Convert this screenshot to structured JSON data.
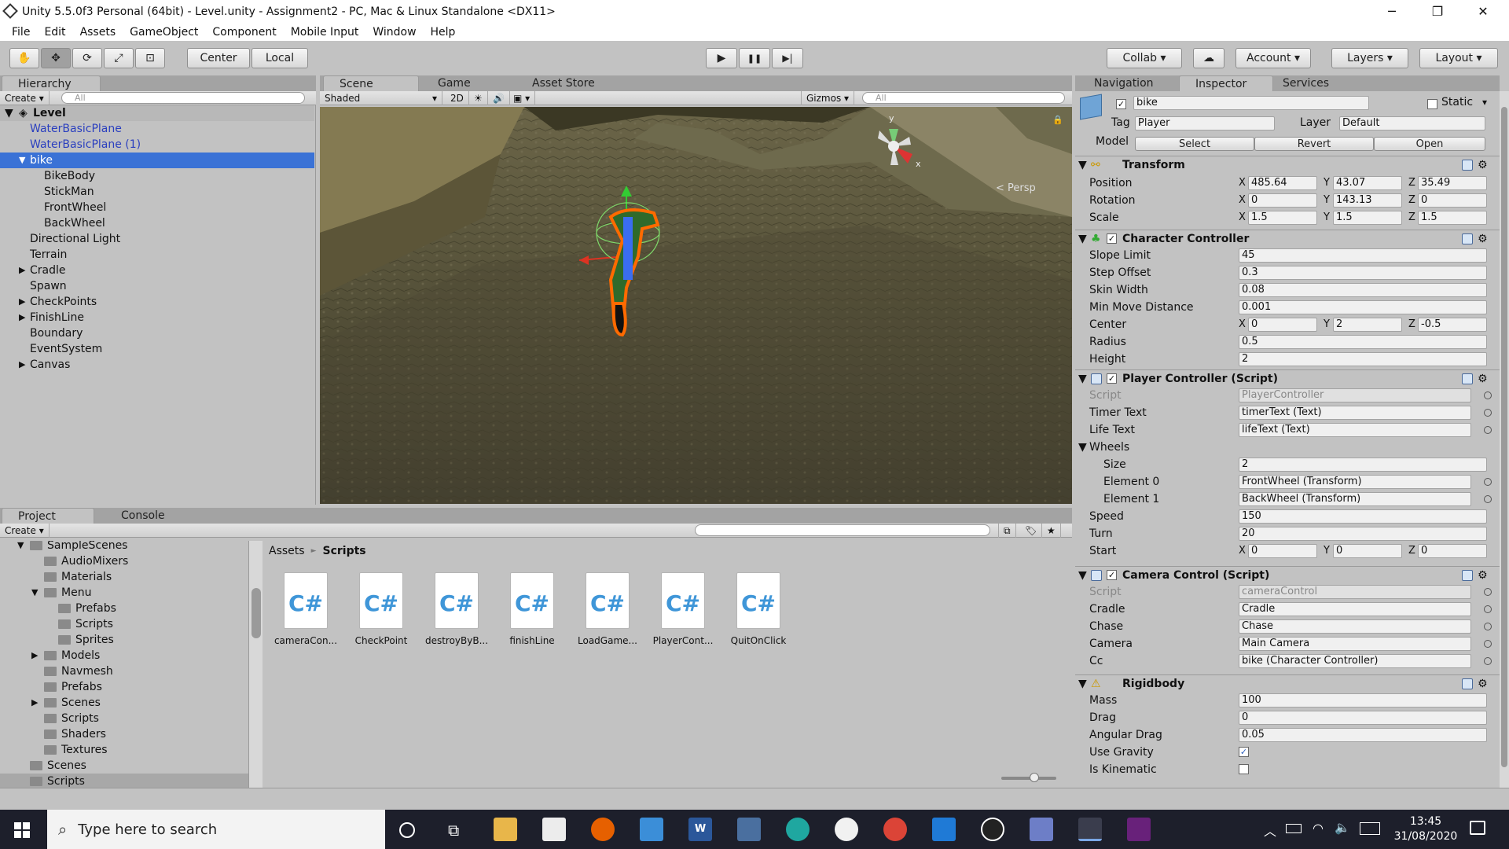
{
  "window": {
    "title": "Unity 5.5.0f3 Personal (64bit) - Level.unity - Assignment2 - PC, Mac & Linux Standalone <DX11>",
    "minimize": "─",
    "maximize": "❐",
    "close": "✕"
  },
  "menu": [
    "File",
    "Edit",
    "Assets",
    "GameObject",
    "Component",
    "Mobile Input",
    "Window",
    "Help"
  ],
  "toolbar": {
    "center": "Center",
    "local": "Local",
    "collab": "Collab",
    "account": "Account",
    "layers": "Layers",
    "layout": "Layout",
    "play": "▶",
    "pause": "❚❚",
    "step": "▶|"
  },
  "hierarchy": {
    "tab": "Hierarchy",
    "create": "Create",
    "search_placeholder": "All",
    "scene": "Level",
    "items": [
      {
        "label": "WaterBasicPlane",
        "indent": 1,
        "prefab": true,
        "arrow": ""
      },
      {
        "label": "WaterBasicPlane (1)",
        "indent": 1,
        "prefab": true,
        "arrow": ""
      },
      {
        "label": "bike",
        "indent": 1,
        "selected": true,
        "arrow": "▼"
      },
      {
        "label": "BikeBody",
        "indent": 2,
        "arrow": ""
      },
      {
        "label": "StickMan",
        "indent": 2,
        "arrow": ""
      },
      {
        "label": "FrontWheel",
        "indent": 2,
        "arrow": ""
      },
      {
        "label": "BackWheel",
        "indent": 2,
        "arrow": ""
      },
      {
        "label": "Directional Light",
        "indent": 1,
        "arrow": ""
      },
      {
        "label": "Terrain",
        "indent": 1,
        "arrow": ""
      },
      {
        "label": "Cradle",
        "indent": 1,
        "arrow": "▶"
      },
      {
        "label": "Spawn",
        "indent": 1,
        "arrow": ""
      },
      {
        "label": "CheckPoints",
        "indent": 1,
        "arrow": "▶"
      },
      {
        "label": "FinishLine",
        "indent": 1,
        "arrow": "▶"
      },
      {
        "label": "Boundary",
        "indent": 1,
        "arrow": ""
      },
      {
        "label": "EventSystem",
        "indent": 1,
        "arrow": ""
      },
      {
        "label": "Canvas",
        "indent": 1,
        "arrow": "▶"
      }
    ]
  },
  "scene": {
    "tabs": [
      "Scene",
      "Game",
      "Asset Store"
    ],
    "shading": "Shaded",
    "mode2d": "2D",
    "gizmos": "Gizmos",
    "search_placeholder": "All",
    "persp": "< Persp",
    "axis_y": "y",
    "axis_x": "x"
  },
  "project": {
    "tabs": [
      "Project",
      "Console"
    ],
    "create": "Create",
    "breadcrumb_root": "Assets",
    "breadcrumb_sep": "►",
    "breadcrumb_current": "Scripts",
    "tree": [
      {
        "label": "SampleScenes",
        "indent": 1,
        "arrow": "▼"
      },
      {
        "label": "AudioMixers",
        "indent": 2,
        "arrow": ""
      },
      {
        "label": "Materials",
        "indent": 2,
        "arrow": ""
      },
      {
        "label": "Menu",
        "indent": 2,
        "arrow": "▼"
      },
      {
        "label": "Prefabs",
        "indent": 3,
        "arrow": ""
      },
      {
        "label": "Scripts",
        "indent": 3,
        "arrow": ""
      },
      {
        "label": "Sprites",
        "indent": 3,
        "arrow": ""
      },
      {
        "label": "Models",
        "indent": 2,
        "arrow": "▶"
      },
      {
        "label": "Navmesh",
        "indent": 2,
        "arrow": ""
      },
      {
        "label": "Prefabs",
        "indent": 2,
        "arrow": ""
      },
      {
        "label": "Scenes",
        "indent": 2,
        "arrow": "▶"
      },
      {
        "label": "Scripts",
        "indent": 2,
        "arrow": ""
      },
      {
        "label": "Shaders",
        "indent": 2,
        "arrow": ""
      },
      {
        "label": "Textures",
        "indent": 2,
        "arrow": ""
      },
      {
        "label": "Scenes",
        "indent": 1,
        "arrow": ""
      },
      {
        "label": "Scripts",
        "indent": 1,
        "arrow": "",
        "selected": true
      }
    ],
    "assets": [
      "cameraCon...",
      "CheckPoint",
      "destroyByB...",
      "finishLine",
      "LoadGame...",
      "PlayerCont...",
      "QuitOnClick"
    ],
    "cs_glyph": "C#"
  },
  "inspector": {
    "tabs": [
      "Navigation",
      "Inspector",
      "Services"
    ],
    "object_name": "bike",
    "static_label": "Static",
    "tag_label": "Tag",
    "tag": "Player",
    "layer_label": "Layer",
    "layer": "Default",
    "model_label": "Model",
    "select": "Select",
    "revert": "Revert",
    "open": "Open",
    "transform": {
      "title": "Transform",
      "position": {
        "label": "Position",
        "x": "485.64",
        "y": "43.07",
        "z": "35.49"
      },
      "rotation": {
        "label": "Rotation",
        "x": "0",
        "y": "143.13",
        "z": "0"
      },
      "scale": {
        "label": "Scale",
        "x": "1.5",
        "y": "1.5",
        "z": "1.5"
      }
    },
    "charctrl": {
      "title": "Character Controller",
      "slope_label": "Slope Limit",
      "slope": "45",
      "step_label": "Step Offset",
      "step": "0.3",
      "skin_label": "Skin Width",
      "skin": "0.08",
      "minmove_label": "Min Move Distance",
      "minmove": "0.001",
      "center_label": "Center",
      "cx": "0",
      "cy": "2",
      "cz": "-0.5",
      "radius_label": "Radius",
      "radius": "0.5",
      "height_label": "Height",
      "height": "2"
    },
    "player": {
      "title": "Player Controller (Script)",
      "script_label": "Script",
      "script": "PlayerController",
      "timer_label": "Timer Text",
      "timer": "timerText (Text)",
      "life_label": "Life Text",
      "life": "lifeText (Text)",
      "wheels_label": "Wheels",
      "size_label": "Size",
      "size": "2",
      "el0_label": "Element 0",
      "el0": "FrontWheel (Transform)",
      "el1_label": "Element 1",
      "el1": "BackWheel (Transform)",
      "speed_label": "Speed",
      "speed": "150",
      "turn_label": "Turn",
      "turn": "20",
      "start_label": "Start",
      "sx": "0",
      "sy": "0",
      "sz": "0"
    },
    "camera": {
      "title": "Camera Control (Script)",
      "script_label": "Script",
      "script": "cameraControl",
      "cradle_label": "Cradle",
      "cradle": "Cradle",
      "chase_label": "Chase",
      "chase": "Chase",
      "camera_label": "Camera",
      "camera": "Main Camera",
      "cc_label": "Cc",
      "cc": "bike (Character Controller)"
    },
    "rigidbody": {
      "title": "Rigidbody",
      "mass_label": "Mass",
      "mass": "100",
      "drag_label": "Drag",
      "drag": "0",
      "adrag_label": "Angular Drag",
      "adrag": "0.05",
      "gravity_label": "Use Gravity",
      "gravity_checked": "✓",
      "kinematic_label": "Is Kinematic"
    }
  },
  "taskbar": {
    "search_placeholder": "Type here to search",
    "time": "13:45",
    "date": "31/08/2020"
  },
  "colors": {
    "selection": "#3a72d6",
    "prefab_text": "#2a3fbf",
    "taskbar": "#1d1f2b"
  }
}
